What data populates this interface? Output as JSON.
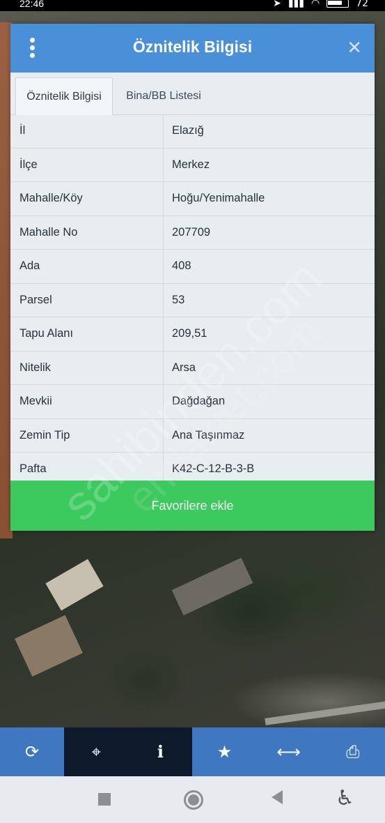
{
  "status_bar": {
    "time": "22:46",
    "battery": "72"
  },
  "dialog": {
    "title": "Öznitelik Bilgisi",
    "close_glyph": "✕",
    "tabs": [
      {
        "label": "Öznitelik Bilgisi",
        "active": true
      },
      {
        "label": "Bina/BB Listesi",
        "active": false
      }
    ],
    "rows": [
      {
        "key": "İl",
        "value": "Elazığ"
      },
      {
        "key": "İlçe",
        "value": "Merkez"
      },
      {
        "key": "Mahalle/Köy",
        "value": "Hoğu/Yenimahalle"
      },
      {
        "key": "Mahalle No",
        "value": "207709"
      },
      {
        "key": "Ada",
        "value": "408"
      },
      {
        "key": "Parsel",
        "value": "53"
      },
      {
        "key": "Tapu Alanı",
        "value": "209,51"
      },
      {
        "key": "Nitelik",
        "value": "Arsa"
      },
      {
        "key": "Mevkii",
        "value": "Dağdağan"
      },
      {
        "key": "Zemin Tip",
        "value": "Ana Taşınmaz"
      },
      {
        "key": "Pafta",
        "value": "K42-C-12-B-3-B"
      }
    ],
    "favorite_button": "Favorilere ekle"
  },
  "watermark": [
    "sahibinden.com",
    "emlakjet.com"
  ],
  "toolbar": {
    "items": [
      {
        "icon": "refresh-icon",
        "glyph": "⟳"
      },
      {
        "icon": "crosshair-icon",
        "glyph": "⌖"
      },
      {
        "icon": "info-icon",
        "glyph": "ℹ"
      },
      {
        "icon": "star-icon",
        "glyph": "★"
      },
      {
        "icon": "measure-icon",
        "glyph": "⟷"
      },
      {
        "icon": "print-icon",
        "glyph": "⎙"
      }
    ]
  },
  "navbar": {
    "icons": [
      "recents-icon",
      "home-icon",
      "back-icon",
      "accessibility-icon"
    ]
  },
  "colors": {
    "header_blue": "#4a90d9",
    "favorite_green": "#3cc95d",
    "toolbar_blue": "#3f78c1",
    "toolbar_dark": "#0d1a2c"
  }
}
